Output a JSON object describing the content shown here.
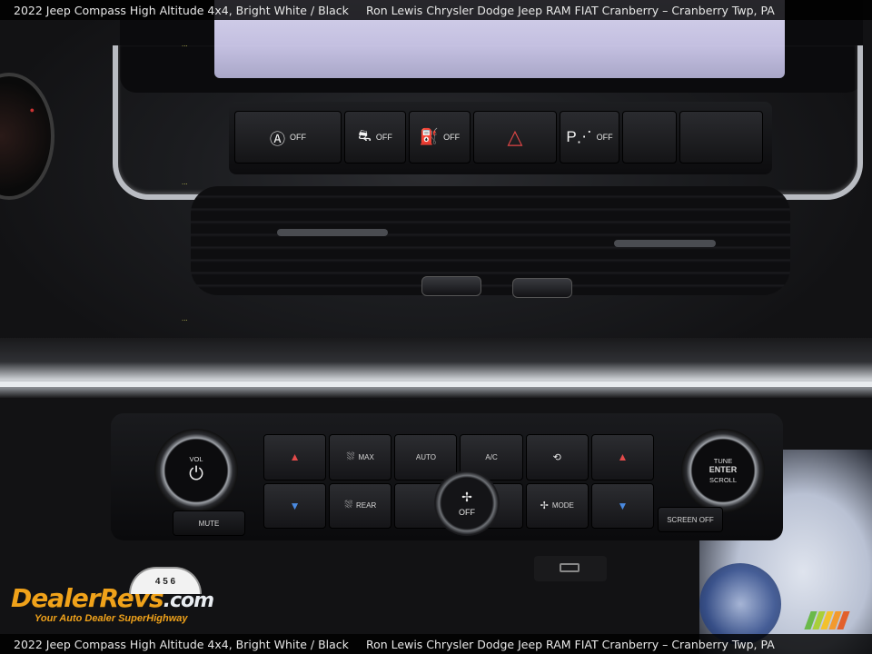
{
  "caption": {
    "vehicle": "2022 Jeep Compass High Altitude 4x4,  Bright White / Black",
    "dealer": "Ron Lewis Chrysler Dodge Jeep RAM FIAT Cranberry – Cranberry Twp, PA"
  },
  "top_buttons": [
    {
      "icon": "auto-stop-icon",
      "glyph": "Ⓐ",
      "label": "OFF"
    },
    {
      "icon": "stability-icon",
      "glyph": "⛐",
      "label": "OFF"
    },
    {
      "icon": "lane-assist-icon",
      "glyph": "⛽",
      "label": "OFF"
    },
    {
      "icon": "hazard-icon",
      "glyph": "△",
      "label": ""
    },
    {
      "icon": "park-assist-icon",
      "glyph": "P⋰",
      "label": "OFF"
    },
    {
      "icon": "blank",
      "glyph": "",
      "label": ""
    },
    {
      "icon": "blank",
      "glyph": "",
      "label": ""
    }
  ],
  "climate": {
    "left_knob": {
      "label": "VOL",
      "glyph": "⏻"
    },
    "right_knob": {
      "line1": "TUNE",
      "line2": "ENTER",
      "line3": "SCROLL"
    },
    "fan_knob": {
      "label": "OFF",
      "glyph": "✢"
    },
    "mute": "MUTE",
    "screen_off": "SCREEN OFF",
    "row1": [
      {
        "icon": "temp-up-left-icon",
        "glyph": "▲",
        "label": ""
      },
      {
        "icon": "max-defrost-icon",
        "glyph": "⛆",
        "label": "MAX"
      },
      {
        "icon": "",
        "glyph": "",
        "label": "AUTO"
      },
      {
        "icon": "",
        "glyph": "",
        "label": "A/C"
      },
      {
        "icon": "recirculation-icon",
        "glyph": "⟲",
        "label": ""
      },
      {
        "icon": "temp-up-right-icon",
        "glyph": "▲",
        "label": ""
      }
    ],
    "row2": [
      {
        "icon": "temp-down-left-icon",
        "glyph": "▼",
        "label": ""
      },
      {
        "icon": "rear-defrost-icon",
        "glyph": "⛆",
        "label": "REAR"
      },
      {
        "icon": "",
        "glyph": "",
        "label": ""
      },
      {
        "icon": "",
        "glyph": "",
        "label": ""
      },
      {
        "icon": "mode-icon",
        "glyph": "✢",
        "label": "MODE"
      },
      {
        "icon": "temp-down-right-icon",
        "glyph": "▼",
        "label": ""
      }
    ]
  },
  "watermark": {
    "dealer": "Dealer",
    "revs": "Revs",
    "com": ".com",
    "tagline": "Your Auto Dealer SuperHighway",
    "gauge": "4 5 6"
  },
  "colors": {
    "watermark_orange": "#f0a21a",
    "hazard_red": "#e04646",
    "temp_up_red": "#e24a4a",
    "temp_down_blue": "#4a8ae0",
    "stripes": [
      "#6ab94a",
      "#a9cf3a",
      "#f2c12e",
      "#f29a2e",
      "#e2602b"
    ]
  }
}
